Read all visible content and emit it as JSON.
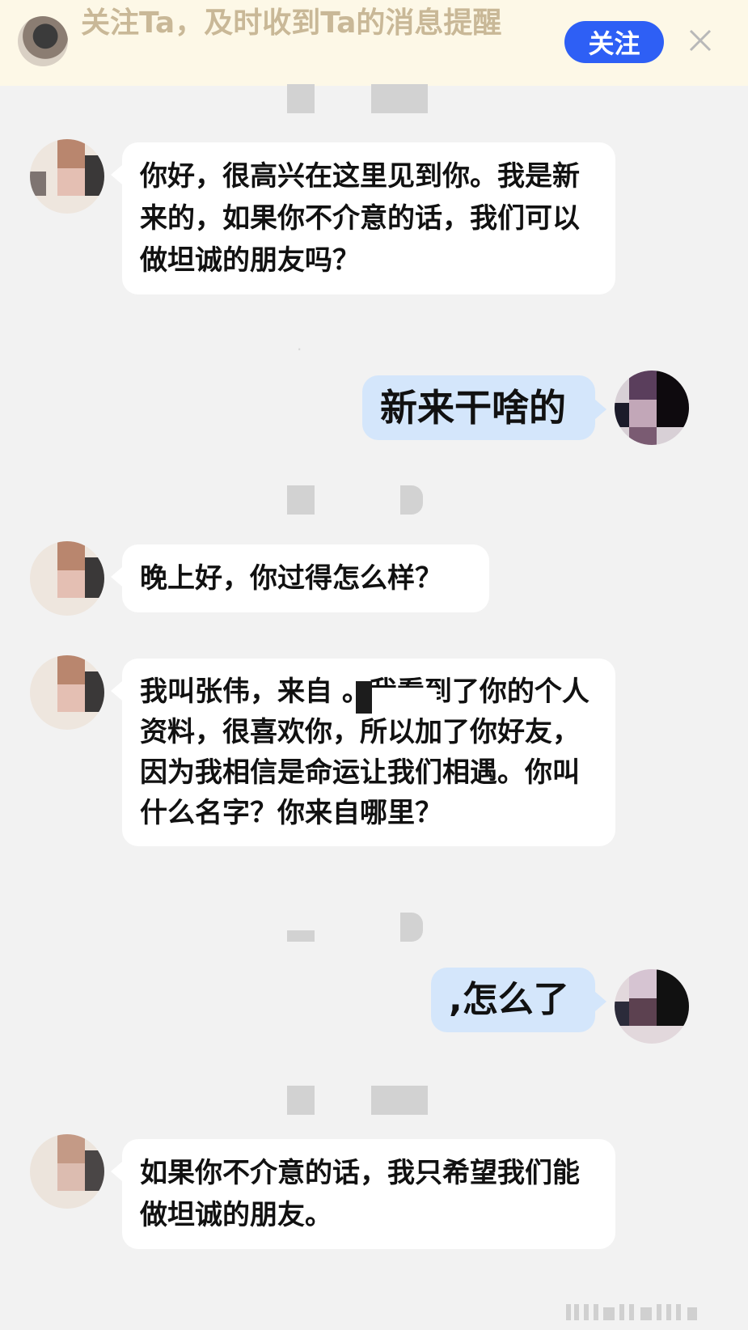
{
  "banner": {
    "text": "关注Ta，及时收到Ta的消息提醒",
    "follow_label": "关注",
    "close_icon": "close-icon",
    "text_color": "#c9b897",
    "button_color": "#2e5ff5"
  },
  "timestamps": [
    "",
    "·",
    "",
    "",
    ""
  ],
  "messages": [
    {
      "side": "in",
      "text": "你好，很高兴在这里见到你。我是新来的，如果你不介意的话，我们可以做坦诚的朋友吗？"
    },
    {
      "side": "out",
      "text": "新来干啥的"
    },
    {
      "side": "in",
      "text": "晚上好，你过得怎么样？"
    },
    {
      "side": "in",
      "text": "我叫张伟，来自      。我看到了你的个人资料，很喜欢你，所以加了你好友，因为我相信是命运让我们相遇。你叫什么名字？你来自哪里？"
    },
    {
      "side": "out",
      "text": ",怎么了"
    },
    {
      "side": "in",
      "text": "如果你不介意的话，我只希望我们能做坦诚的朋友。"
    }
  ],
  "colors": {
    "background": "#f2f2f2",
    "incoming_bubble": "#ffffff",
    "outgoing_bubble": "#d4e6fb"
  }
}
